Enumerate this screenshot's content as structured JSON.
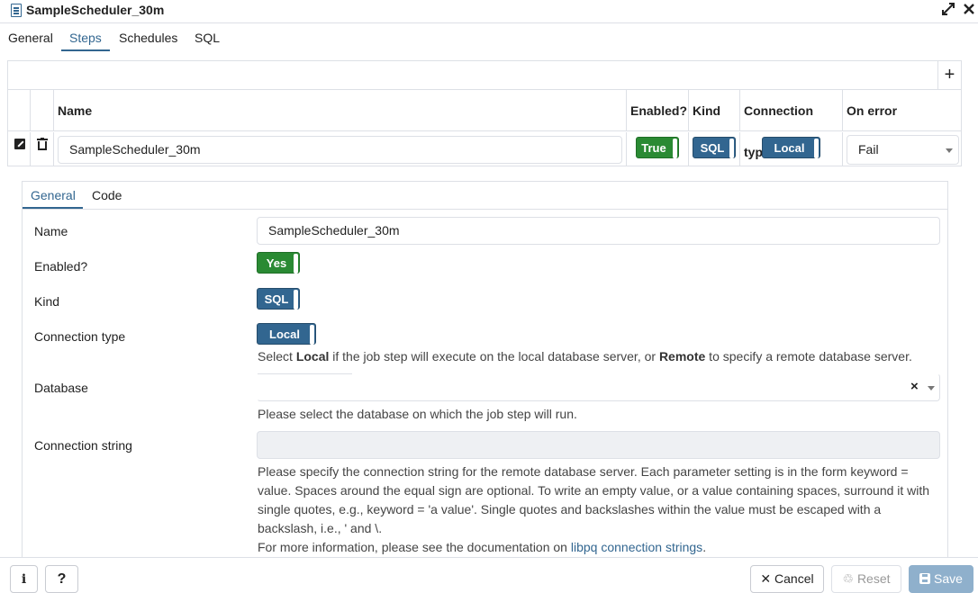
{
  "window": {
    "title": "SampleScheduler_30m",
    "expand_icon": "expand-icon",
    "close_icon": "close-icon"
  },
  "tabs": [
    {
      "label": "General",
      "active": false
    },
    {
      "label": "Steps",
      "active": true
    },
    {
      "label": "Schedules",
      "active": false
    },
    {
      "label": "SQL",
      "active": false
    }
  ],
  "steps_grid": {
    "add_label": "+",
    "columns": {
      "name": "Name",
      "enabled": "Enabled?",
      "kind": "Kind",
      "connection_type": "Connection type",
      "on_error": "On error"
    },
    "rows": [
      {
        "name": "SampleScheduler_30m",
        "enabled": "True",
        "kind": "SQL",
        "connection_type": "Local",
        "on_error": "Fail"
      }
    ]
  },
  "step_editor": {
    "tabs": [
      {
        "label": "General",
        "active": true
      },
      {
        "label": "Code",
        "active": false
      }
    ],
    "fields": {
      "name": {
        "label": "Name",
        "value": "SampleScheduler_30m"
      },
      "enabled": {
        "label": "Enabled?",
        "value": "Yes"
      },
      "kind": {
        "label": "Kind",
        "value": "SQL"
      },
      "connection_type": {
        "label": "Connection type",
        "value": "Local",
        "help_pre": "Select ",
        "help_local": "Local",
        "help_mid": " if the job step will execute on the local database server, or ",
        "help_remote": "Remote",
        "help_post": " to specify a remote database server."
      },
      "database": {
        "label": "Database",
        "value": "",
        "clear_label": "×",
        "help": "Please select the database on which the job step will run."
      },
      "connection_string": {
        "label": "Connection string",
        "value": "",
        "help": "Please specify the connection string for the remote database server. Each parameter setting is in the form keyword = value. Spaces around the equal sign are optional. To write an empty value, or a value containing spaces, surround it with single quotes, e.g., keyword = 'a value'. Single quotes and backslashes within the value must be escaped with a backslash, i.e., ' and \\.",
        "help_more_pre": "For more information, please see the documentation on ",
        "help_link": "libpq connection strings",
        "help_more_post": "."
      }
    }
  },
  "footer": {
    "info_label": "i",
    "help_label": "?",
    "cancel_label": "Cancel",
    "reset_label": "Reset",
    "save_label": "Save"
  },
  "colors": {
    "accent": "#326690",
    "toggle_green": "#2a8a33",
    "save_button": "#8fb0cc"
  }
}
